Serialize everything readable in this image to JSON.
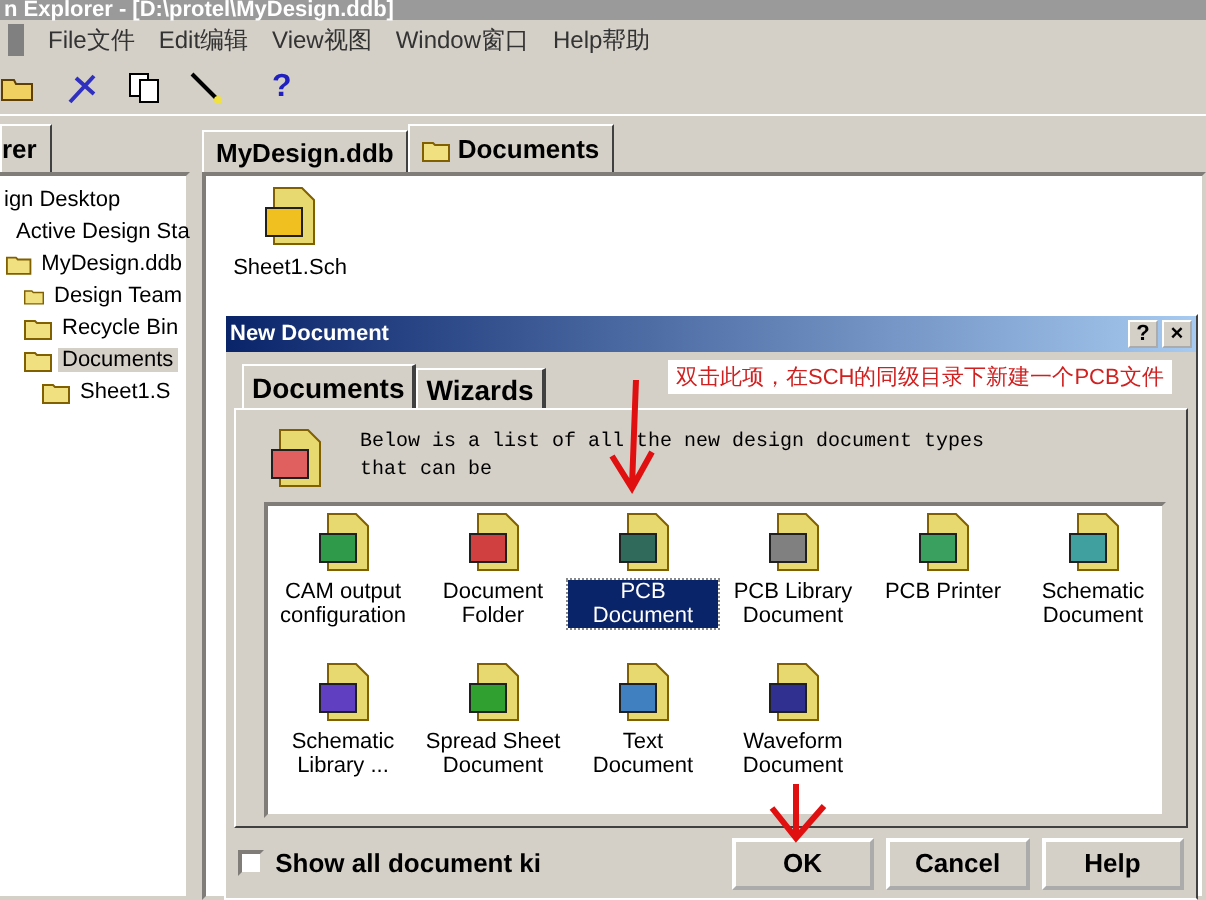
{
  "window": {
    "title": "n Explorer - [D:\\protel\\MyDesign.ddb]"
  },
  "menu": [
    "File文件",
    "Edit编辑",
    "View视图",
    "Window窗口",
    "Help帮助"
  ],
  "toolbar": {
    "help_label": "?"
  },
  "explorer": {
    "tab": "rer",
    "tree": [
      {
        "label": "ign Desktop",
        "selected": false,
        "children": [
          {
            "label": "Active Design Sta",
            "selected": false
          },
          {
            "label": "MyDesign.ddb",
            "selected": false,
            "children": [
              {
                "label": "Design Team",
                "selected": false
              },
              {
                "label": "Recycle Bin",
                "selected": false
              },
              {
                "label": "Documents",
                "selected": true,
                "children": [
                  {
                    "label": "Sheet1.S",
                    "selected": false
                  }
                ]
              }
            ]
          }
        ]
      }
    ]
  },
  "tabs": [
    {
      "label": "MyDesign.ddb",
      "selected": false,
      "folder": false
    },
    {
      "label": "Documents",
      "selected": true,
      "folder": true
    }
  ],
  "files": [
    {
      "label": "Sheet1.Sch"
    }
  ],
  "dialog": {
    "title": "New Document",
    "help_button": "?",
    "close_button": "×",
    "tabs": [
      {
        "label": "Documents",
        "selected": true
      },
      {
        "label": "Wizards",
        "selected": false
      }
    ],
    "annotation": "双击此项，在SCH的同级目录下新建一个PCB文件",
    "description": "Below is a list of all the new design document types that can be",
    "items": [
      {
        "label": "CAM output configuration",
        "selected": false,
        "color": "#2e9a4a"
      },
      {
        "label": "Document Folder",
        "selected": false,
        "color": "#d04040"
      },
      {
        "label": "PCB Document",
        "selected": true,
        "color": "#2f6a5a"
      },
      {
        "label": "PCB Library Document",
        "selected": false,
        "color": "#808080"
      },
      {
        "label": "PCB Printer",
        "selected": false,
        "color": "#3aa060"
      },
      {
        "label": "Schematic Document",
        "selected": false,
        "color": "#40a0a0"
      },
      {
        "label": "Schematic Library ...",
        "selected": false,
        "color": "#6040c0"
      },
      {
        "label": "Spread Sheet Document",
        "selected": false,
        "color": "#30a030"
      },
      {
        "label": "Text Document",
        "selected": false,
        "color": "#4080c0"
      },
      {
        "label": "Waveform Document",
        "selected": false,
        "color": "#303090"
      }
    ],
    "show_all": {
      "label": "Show all document ki",
      "checked": false
    },
    "buttons": [
      "OK",
      "Cancel",
      "Help"
    ]
  }
}
